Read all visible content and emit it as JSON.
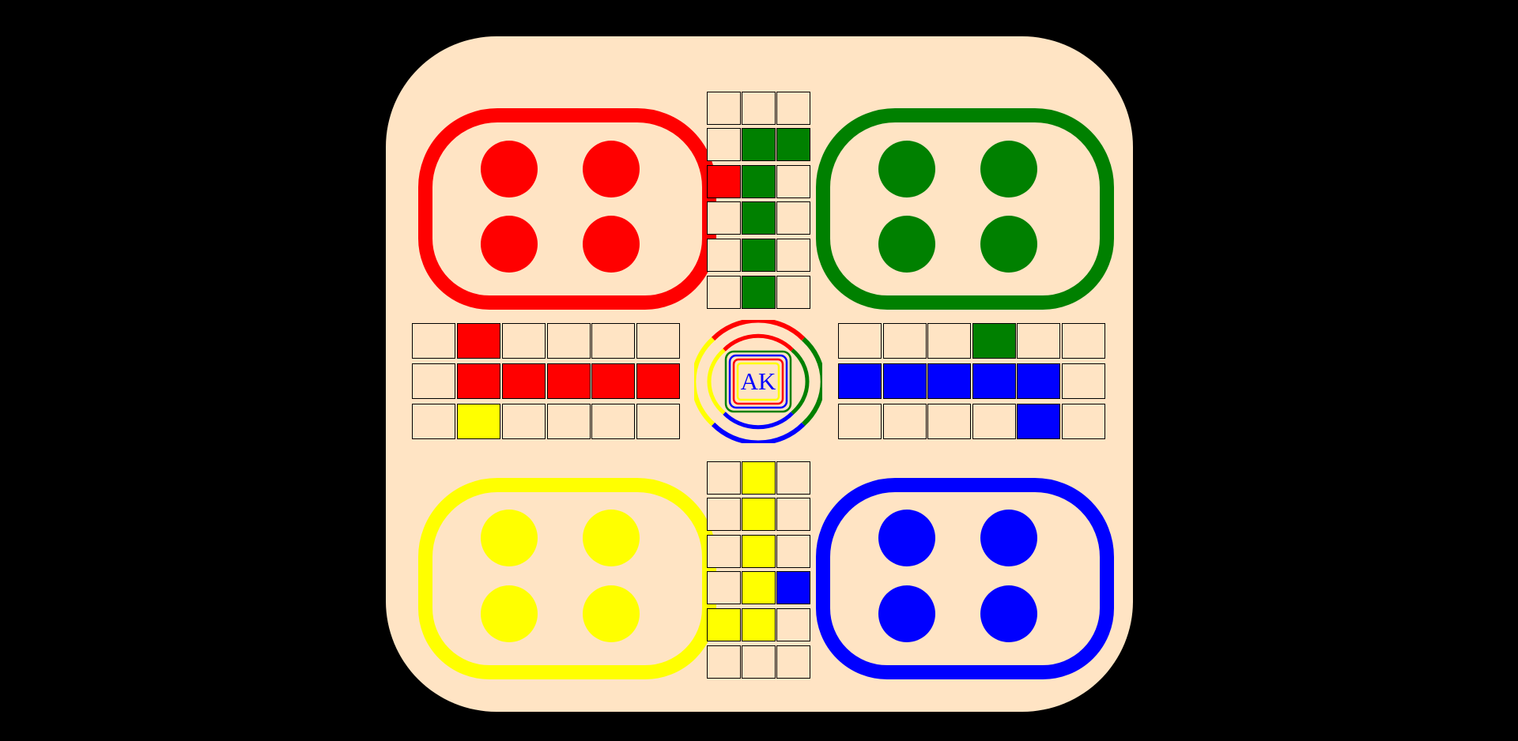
{
  "game": {
    "center_label": "AK",
    "colors": {
      "red": "#ff0000",
      "green": "#008000",
      "yellow": "#ffff00",
      "blue": "#0000ff",
      "board": "#ffe4c4",
      "background": "#000000",
      "label": "#0000ff"
    },
    "yards": [
      {
        "name": "red",
        "tokens_at_home": 4
      },
      {
        "name": "green",
        "tokens_at_home": 4
      },
      {
        "name": "yellow",
        "tokens_at_home": 4
      },
      {
        "name": "blue",
        "tokens_at_home": 4
      }
    ]
  }
}
